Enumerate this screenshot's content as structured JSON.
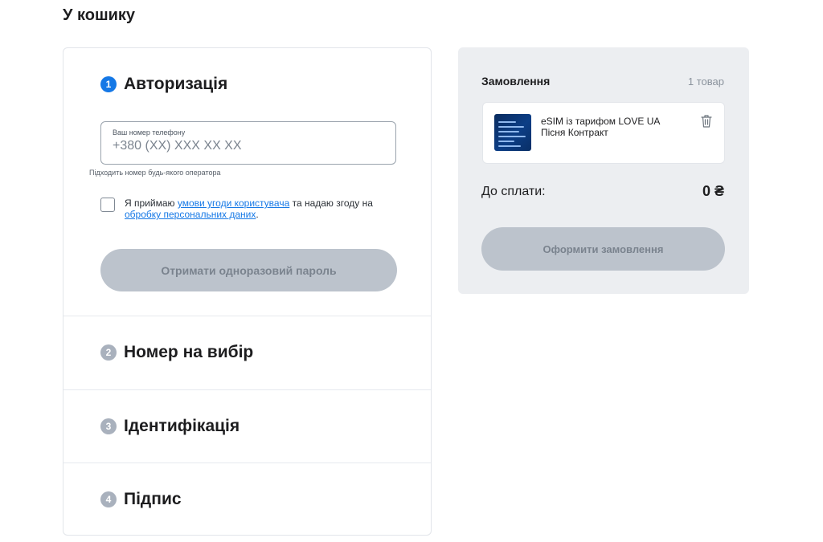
{
  "page": {
    "title": "У кошику"
  },
  "auth": {
    "step_number": "1",
    "title": "Авторизація",
    "phone_label": "Ваш номер телефону",
    "phone_placeholder": "+380 (XX) XXX XX XX",
    "helper": "Підходить номер будь-якого оператора",
    "consent_prefix": "Я приймаю ",
    "consent_link1": "умови угоди користувача",
    "consent_middle": " та надаю згоду на ",
    "consent_link2": "обробку персональних даних",
    "consent_suffix": ".",
    "otp_button": "Отримати одноразовий пароль"
  },
  "steps": [
    {
      "number": "2",
      "title": "Номер на вибір"
    },
    {
      "number": "3",
      "title": "Ідентифікація"
    },
    {
      "number": "4",
      "title": "Підпис"
    }
  ],
  "order": {
    "title": "Замовлення",
    "count": "1 товар",
    "item_line1": "eSIM із тарифом LOVE UA",
    "item_line2": "Пісня Контракт",
    "total_label": "До сплати:",
    "total_value": "0 ₴",
    "checkout_button": "Оформити замовлення"
  },
  "colors": {
    "accent": "#1578e6",
    "inactive_step": "#a9b1bd",
    "disabled_button": "#bcc3cc",
    "order_panel_bg": "#eceef1"
  },
  "icons": {
    "delete": "trash-icon"
  }
}
